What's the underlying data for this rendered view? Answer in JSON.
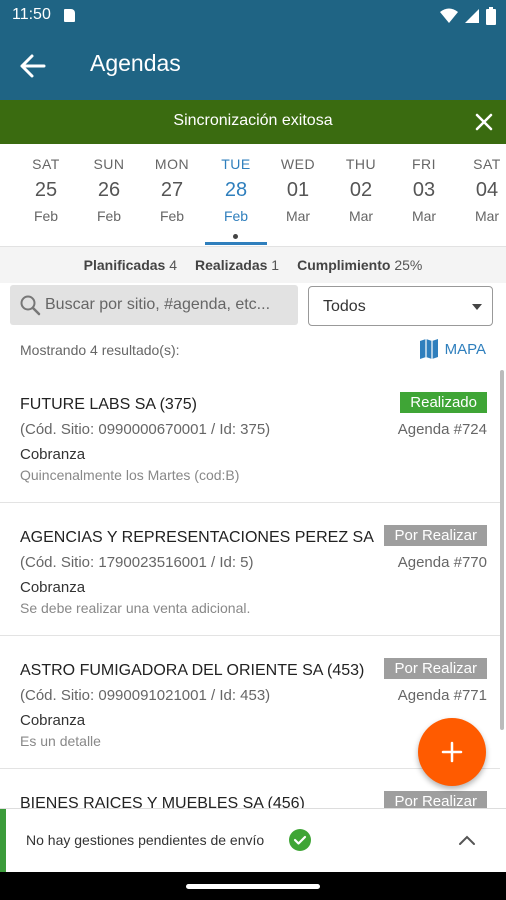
{
  "status_bar": {
    "time": "11:50"
  },
  "app_bar": {
    "title": "Agendas"
  },
  "banner": {
    "text": "Sincronización exitosa"
  },
  "calendar": {
    "days": [
      {
        "dow": "SAT",
        "num": "25",
        "mon": "Feb"
      },
      {
        "dow": "SUN",
        "num": "26",
        "mon": "Feb"
      },
      {
        "dow": "MON",
        "num": "27",
        "mon": "Feb"
      },
      {
        "dow": "TUE",
        "num": "28",
        "mon": "Feb"
      },
      {
        "dow": "WED",
        "num": "01",
        "mon": "Mar"
      },
      {
        "dow": "THU",
        "num": "02",
        "mon": "Mar"
      },
      {
        "dow": "FRI",
        "num": "03",
        "mon": "Mar"
      },
      {
        "dow": "SAT",
        "num": "04",
        "mon": "Mar"
      }
    ],
    "selected_index": 3
  },
  "stats": {
    "planificadas_label": "Planificadas",
    "planificadas_value": "4",
    "realizadas_label": "Realizadas",
    "realizadas_value": "1",
    "cumplimiento_label": "Cumplimiento",
    "cumplimiento_value": "25%"
  },
  "search": {
    "placeholder": "Buscar por sitio, #agenda, etc..."
  },
  "filter": {
    "value": "Todos"
  },
  "results": {
    "showing": "Mostrando 4 resultado(s):",
    "map_label": "MAPA"
  },
  "items": [
    {
      "name": "FUTURE LABS SA (375)",
      "cod": "(Cód. Sitio: 0990000670001 / Id: 375)",
      "tipo": "Cobranza",
      "detail": "Quincenalmente los Martes (cod:B)",
      "status": "Realizado",
      "agenda": "Agenda #724"
    },
    {
      "name": "AGENCIAS Y REPRESENTACIONES PEREZ SA",
      "cod": "(Cód. Sitio: 1790023516001 / Id: 5)",
      "tipo": "Cobranza",
      "detail": "Se debe realizar una venta adicional.",
      "status": "Por Realizar",
      "agenda": "Agenda #770"
    },
    {
      "name": "ASTRO FUMIGADORA DEL ORIENTE SA (453)",
      "cod": "(Cód. Sitio: 0990091021001 / Id: 453)",
      "tipo": "Cobranza",
      "detail": "Es un detalle",
      "status": "Por Realizar",
      "agenda": "Agenda #771"
    },
    {
      "name": "BIENES RAICES Y MUEBLES SA (456)",
      "cod": "",
      "tipo": "",
      "detail": "",
      "status": "Por Realizar",
      "agenda": ""
    }
  ],
  "colors": {
    "primary": "#1f6484",
    "success_banner": "#3a6b10",
    "done_badge": "#3fa536",
    "pending_badge": "#9e9e9e",
    "fab": "#ff5b00",
    "accent_blue": "#2f7fbd"
  },
  "bottom_bar": {
    "text": "No hay gestiones pendientes de envío"
  }
}
